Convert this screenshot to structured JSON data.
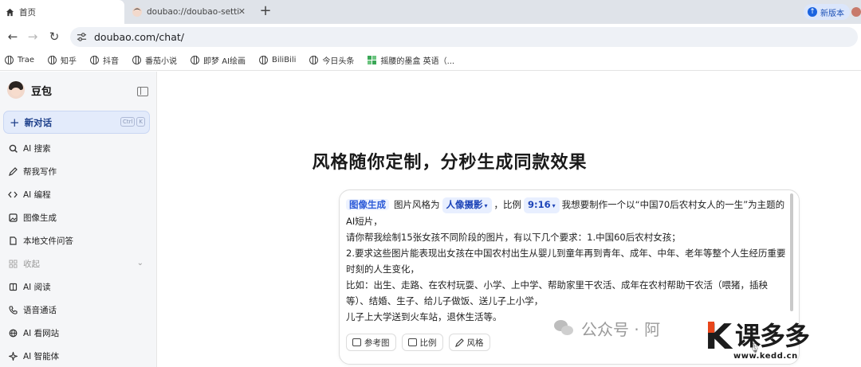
{
  "browser": {
    "tabs": [
      {
        "label": "首页",
        "icon": "home-icon"
      },
      {
        "label": "doubao://doubao-setti",
        "icon": "doubao-avatar-icon"
      }
    ],
    "update_label": "新版本",
    "url": "doubao.com/chat/"
  },
  "bookmarks": [
    {
      "label": "Trae",
      "icon": "globe-icon"
    },
    {
      "label": "知乎",
      "icon": "globe-icon"
    },
    {
      "label": "抖音",
      "icon": "globe-icon"
    },
    {
      "label": "番茄小说",
      "icon": "globe-icon"
    },
    {
      "label": "即梦 AI绘画",
      "icon": "globe-icon"
    },
    {
      "label": "BiliBili",
      "icon": "globe-icon"
    },
    {
      "label": "今日头条",
      "icon": "globe-icon"
    },
    {
      "label": "摇腰的墨盒 英语（...",
      "icon": "app-icon"
    }
  ],
  "sidebar": {
    "brand": "豆包",
    "new_chat": {
      "label": "新对话",
      "keys": [
        "Ctrl",
        "K"
      ]
    },
    "items": [
      {
        "label": "AI 搜索",
        "icon": "search-icon"
      },
      {
        "label": "帮我写作",
        "icon": "pen-icon"
      },
      {
        "label": "AI 编程",
        "icon": "code-icon"
      },
      {
        "label": "图像生成",
        "icon": "image-icon"
      },
      {
        "label": "本地文件问答",
        "icon": "file-icon"
      },
      {
        "label": "收起",
        "icon": "grid-icon"
      },
      {
        "label": "AI 阅读",
        "icon": "book-icon"
      },
      {
        "label": "语音通话",
        "icon": "phone-icon"
      },
      {
        "label": "AI 看网站",
        "icon": "web-icon"
      },
      {
        "label": "AI 智能体",
        "icon": "sparkle-icon"
      }
    ]
  },
  "main": {
    "headline": "风格随你定制，分秒生成同款效果",
    "composer": {
      "skill": "图像生成",
      "style_prefix": "图片风格为",
      "style_value": "人像摄影",
      "ratio_prefix": "，比例",
      "ratio_value": "9:16",
      "line1_rest": "我想要制作一个以“中国70后农村女人的一生”为主题的",
      "line2": "AI短片，",
      "line3": "请你帮我绘制15张女孩不同阶段的图片，有以下几个要求：1.中国60后农村女孩；",
      "line4": "2.要求这些图片能表现出女孩在中国农村出生从婴儿到童年再到青年、成年、中年、老年等整个人生经历重要时刻的人生变化，",
      "line5": "比如：出生、走路、在农村玩耍、小学、上中学、帮助家里干农活、成年在农村帮助干农活（喂猪，插秧等）、结婚、生子、给儿子做饭、送儿子上小学，",
      "line6": "儿子上大学送到火车站，退休生活等。",
      "tools": [
        {
          "label": "参考图",
          "icon": "image-icon"
        },
        {
          "label": "比例",
          "icon": "ratio-icon"
        },
        {
          "label": "风格",
          "icon": "brush-icon"
        }
      ]
    }
  },
  "watermarks": {
    "wechat": "公众号 · 阿",
    "site_name": "课多多",
    "site_url": "www.kedd.cn"
  }
}
